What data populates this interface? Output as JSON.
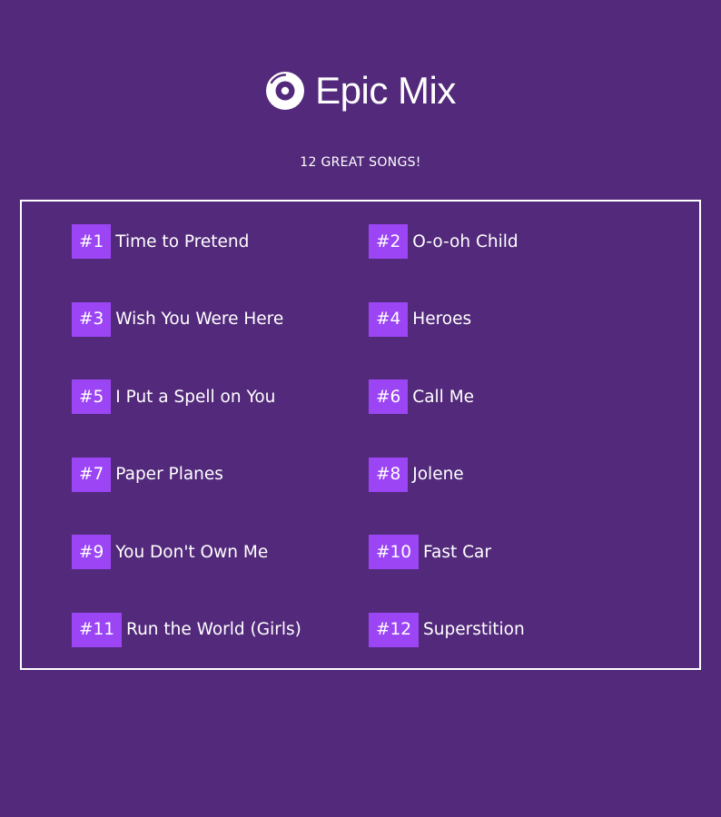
{
  "header": {
    "logo_icon": "vinyl-record-icon",
    "title": "Epic Mix"
  },
  "subtitle": "12 GREAT SONGS!",
  "colors": {
    "background": "#532a7b",
    "badge": "#9b45f5",
    "text": "#ffffff",
    "border": "#ffffff"
  },
  "songs": [
    {
      "rank": "#1",
      "title": "Time to Pretend"
    },
    {
      "rank": "#2",
      "title": "O-o-oh Child"
    },
    {
      "rank": "#3",
      "title": "Wish You Were Here"
    },
    {
      "rank": "#4",
      "title": "Heroes"
    },
    {
      "rank": "#5",
      "title": "I Put a Spell on You"
    },
    {
      "rank": "#6",
      "title": "Call Me"
    },
    {
      "rank": "#7",
      "title": "Paper Planes"
    },
    {
      "rank": "#8",
      "title": "Jolene"
    },
    {
      "rank": "#9",
      "title": "You Don't Own Me"
    },
    {
      "rank": "#10",
      "title": "Fast Car"
    },
    {
      "rank": "#11",
      "title": "Run the World (Girls)"
    },
    {
      "rank": "#12",
      "title": "Superstition"
    }
  ]
}
